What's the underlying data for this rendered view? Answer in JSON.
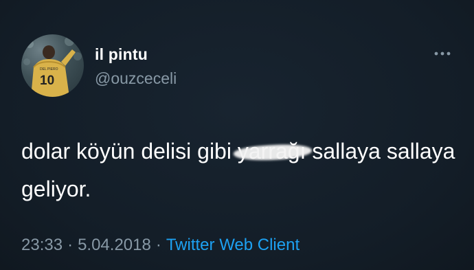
{
  "tweet": {
    "author": {
      "display_name": "il pintu",
      "username": "@ouzceceli",
      "avatar_jersey_number": "10",
      "avatar_jersey_name": "DEL PIERO"
    },
    "more_icon": "more-horizontal-icon",
    "text": {
      "part_before": "dolar köyün delisi gibi ",
      "censored_word": "yarrağı",
      "part_after": "sallaya sallaya geliyor."
    },
    "meta": {
      "time": "23:33",
      "separator": "·",
      "date": "5.04.2018",
      "client": "Twitter Web Client"
    }
  },
  "colors": {
    "background": "#15202b",
    "primary_text": "#ffffff",
    "secondary_text": "#8899a6",
    "link": "#1da1f2"
  }
}
